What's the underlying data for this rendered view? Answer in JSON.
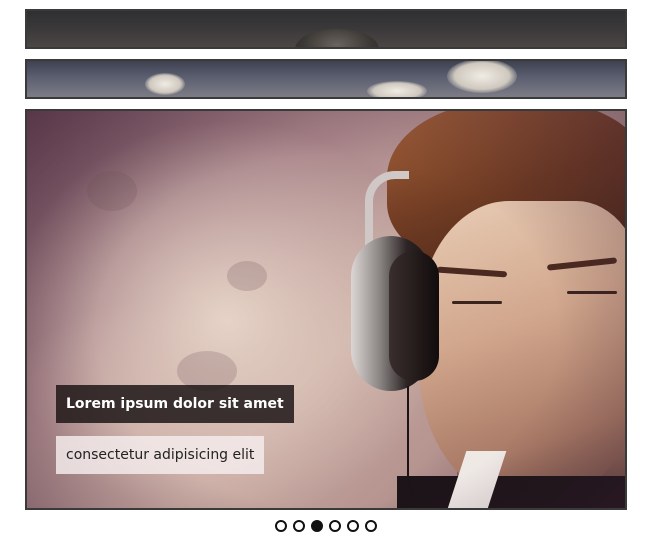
{
  "slider": {
    "caption_title": "Lorem ipsum dolor sit amet",
    "caption_subtitle": "consectetur adipisicing elit",
    "dots": [
      {
        "active": false
      },
      {
        "active": false
      },
      {
        "active": true
      },
      {
        "active": false
      },
      {
        "active": false
      },
      {
        "active": false
      }
    ],
    "active_index": 2
  },
  "colors": {
    "caption_title_bg": "#1e1618",
    "caption_subtitle_bg": "#f5eeee",
    "border": "#3a3a3a",
    "dot": "#111111"
  },
  "icons": {
    "pagination": "circle-dot-icon"
  }
}
